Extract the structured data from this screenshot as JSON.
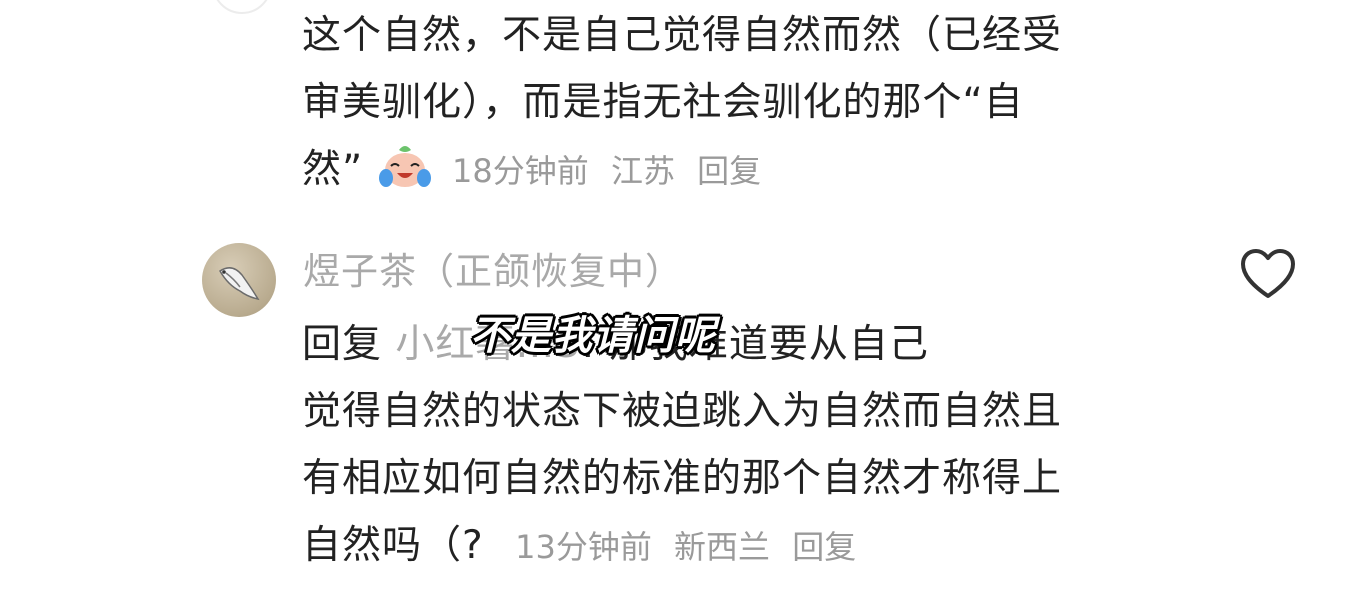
{
  "comment1": {
    "lines": [
      "这个自然，不是自己觉得自然而然（已经受",
      "审美驯化），而是指无社会驯化的那个“自",
      "然”"
    ],
    "emoji": "crying-laughing-face",
    "time": "18分钟前",
    "location": "江苏",
    "reply": "回复"
  },
  "comment2": {
    "username": "煜子茶（正颌恢复中）",
    "reply_prefix": "回复",
    "reply_target": "小红薯…",
    "reply_target_tail": "3",
    "colon": ": ",
    "line1_text": "那我难道要从自己",
    "lines": [
      "觉得自然的状态下被迫跳入为自然而自然且",
      "有相应如何自然的标准的那个自然才称得上",
      "自然吗（?"
    ],
    "time": "13分钟前",
    "location": "新西兰",
    "reply": "回复"
  },
  "overlay_subtitle": "不是我请问呢",
  "icons": {
    "like": "heart-icon",
    "avatar": "avatar"
  },
  "colors": {
    "text": "#222222",
    "meta": "#9a9a9a",
    "username": "#a9a9a9"
  }
}
